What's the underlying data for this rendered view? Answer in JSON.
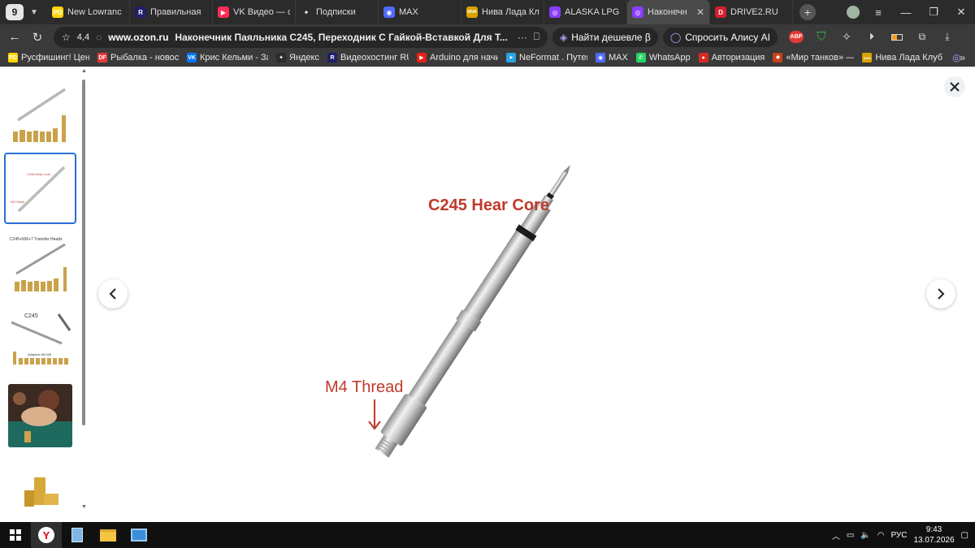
{
  "browser": {
    "tab_count": "9",
    "tabs": [
      {
        "title": "New Lowranc",
        "icon": "PD",
        "color": "#ffd400",
        "active": false
      },
      {
        "title": "Правильная",
        "icon": "R",
        "color": "#1f1f6b",
        "active": false
      },
      {
        "title": "VK Видео — с",
        "icon": "▶",
        "color": "#ff2d55",
        "active": false
      },
      {
        "title": "Подписки",
        "icon": "✦",
        "color": "#2b2b2b",
        "active": false
      },
      {
        "title": "MAX",
        "icon": "◉",
        "color": "#4f6bff",
        "active": false
      },
      {
        "title": "Нива Лада Кл",
        "icon": "NIVA",
        "color": "#d9a200",
        "active": false
      },
      {
        "title": "ALASKA LPG",
        "icon": "◎",
        "color": "#8a3cff",
        "active": false
      },
      {
        "title": "Наконечн",
        "icon": "◎",
        "color": "#8a3cff",
        "active": true
      },
      {
        "title": "DRIVE2.RU",
        "icon": "D",
        "color": "#d2202f",
        "active": false
      }
    ],
    "address": {
      "rating": "4,4",
      "domain": "www.ozon.ru",
      "page_title": "Наконечник Паяльника C245, Переходник С Гайкой-Вставкой Для Т...",
      "find_cheaper": "Найти дешевле β",
      "ask_alice": "Спросить Алису AI"
    },
    "bookmarks": [
      {
        "label": "Русфишинг! Цент",
        "icon": "PD",
        "color": "#ffd400"
      },
      {
        "label": "Рыбалка - новост",
        "icon": "DF",
        "color": "#e53935"
      },
      {
        "label": "Крис Кельми - За",
        "icon": "VK",
        "color": "#0077ff"
      },
      {
        "label": "Яндекс",
        "icon": "✦",
        "color": "#2b2b2b"
      },
      {
        "label": "Видеохостинг RU",
        "icon": "R",
        "color": "#1f1f6b"
      },
      {
        "label": "Arduino для начи",
        "icon": "▶",
        "color": "#e62117"
      },
      {
        "label": "NeFormat . Путеш",
        "icon": "➤",
        "color": "#2aa3e0"
      },
      {
        "label": "MAX",
        "icon": "◉",
        "color": "#4f6bff"
      },
      {
        "label": "WhatsApp",
        "icon": "✆",
        "color": "#25d366"
      },
      {
        "label": "Авторизация",
        "icon": "●",
        "color": "#d52b1e"
      },
      {
        "label": "«Мир танков» — т",
        "icon": "✹",
        "color": "#c8401d"
      },
      {
        "label": "Нива Лада Клуб",
        "icon": "NIVA",
        "color": "#d9a200"
      }
    ]
  },
  "gallery": {
    "thumb2_label_top": "C245 Hear Core",
    "thumb2_label_bottom": "M4 Thread",
    "thumb3_label": "C245+936+7 Transfer Heads",
    "thumb4_label_top": "C245",
    "thumb4_label_bottom": "Adaptive M4 M8",
    "main_label_core": "C245 Hear Core",
    "main_label_thread": "M4 Thread"
  },
  "taskbar": {
    "lang": "РУС",
    "time": "9:43",
    "date": "13.07.2026"
  }
}
